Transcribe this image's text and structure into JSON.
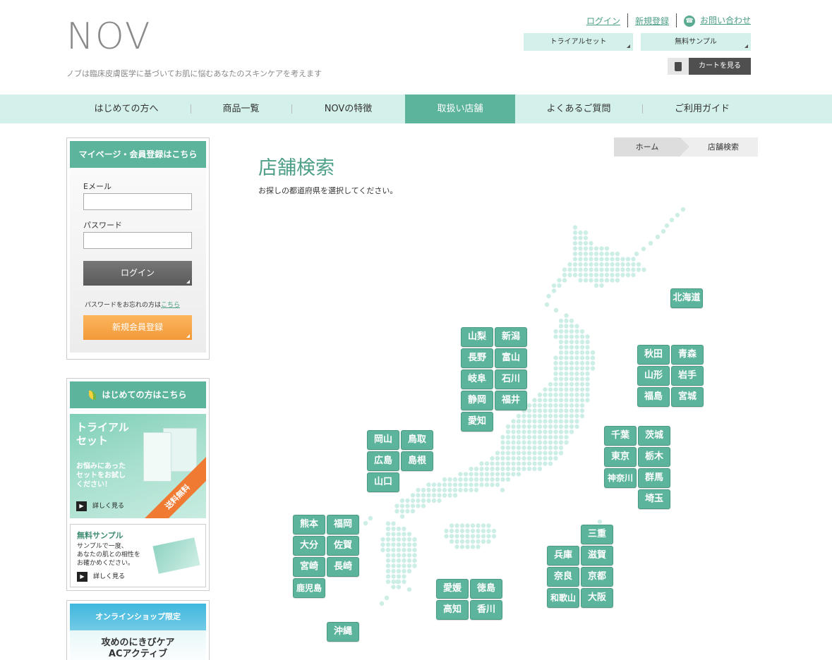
{
  "header": {
    "logo": "NOV",
    "tagline": "ノブは臨床皮膚医学に基づいてお肌に悩むあなたのスキンケアを考えます",
    "links": {
      "login": "ログイン",
      "register": "新規登録",
      "contact": "お問い合わせ"
    },
    "trial_set": "トライアルセット",
    "free_sample": "無料サンプル",
    "cart": "カートを見る"
  },
  "nav": {
    "items": [
      "はじめての方へ",
      "商品一覧",
      "NOVの特徴",
      "取扱い店舗",
      "よくあるご質問",
      "ご利用ガイド"
    ],
    "active": "取扱い店舗"
  },
  "login_box": {
    "title": "マイページ・会員登録はこちら",
    "email_label": "Eメール",
    "email_value": "",
    "password_label": "パスワード",
    "password_value": "",
    "login_button": "ログイン",
    "forgot_text": "パスワードをお忘れの方は",
    "forgot_link": "こちら",
    "register_button": "新規会員登録"
  },
  "beginner_box": {
    "title": "はじめての方はこちら",
    "trial_title_1": "トライアル",
    "trial_title_2": "セット",
    "trial_desc": [
      "お悩みにあった",
      "セットをお試し",
      "ください！"
    ],
    "trial_more": "詳しく見る",
    "free_shipping": "送料無料",
    "sample_title": "無料サンプル",
    "sample_desc": [
      "サンプルで一度、",
      "あなたの肌との相性を",
      "お確かめください。"
    ],
    "sample_more": "詳しく見る"
  },
  "shop_box": {
    "title": "オンラインショップ限定",
    "line1": "攻めのにきびケア",
    "line2": "ACアクティブ"
  },
  "breadcrumb": {
    "home": "ホーム",
    "current": "店舗検索"
  },
  "page": {
    "title": "店舗検索",
    "description": "お探しの都道府県を選択してください。"
  },
  "prefectures": {
    "hokkaido": "北海道",
    "akita": "秋田",
    "aomori": "青森",
    "yamagata": "山形",
    "iwate": "岩手",
    "fukushima": "福島",
    "miyagi": "宮城",
    "yamanashi": "山梨",
    "niigata": "新潟",
    "nagano": "長野",
    "toyama": "富山",
    "gifu": "岐阜",
    "ishikawa": "石川",
    "shizuoka": "静岡",
    "fukui": "福井",
    "aichi": "愛知",
    "chiba": "千葉",
    "ibaraki": "茨城",
    "tokyo": "東京",
    "tochigi": "栃木",
    "kanagawa": "神奈川",
    "gunma": "群馬",
    "saitama": "埼玉",
    "okayama": "岡山",
    "tottori": "鳥取",
    "hiroshima": "広島",
    "shimane": "島根",
    "yamaguchi": "山口",
    "mie": "三重",
    "hyogo": "兵庫",
    "shiga": "滋賀",
    "nara": "奈良",
    "kyoto": "京都",
    "wakayama": "和歌山",
    "osaka": "大阪",
    "ehime": "愛媛",
    "tokushima": "徳島",
    "kochi": "高知",
    "kagawa": "香川",
    "kumamoto": "熊本",
    "fukuoka": "福岡",
    "oita": "大分",
    "saga": "佐賀",
    "miyazaki": "宮崎",
    "nagasaki": "長崎",
    "kagoshima": "鹿児島",
    "okinawa": "沖縄"
  },
  "colors": {
    "accent": "#5bb49b",
    "nav_bg": "#d4f0ea",
    "map_dot": "#cdeee6",
    "register": "#f7a544"
  }
}
